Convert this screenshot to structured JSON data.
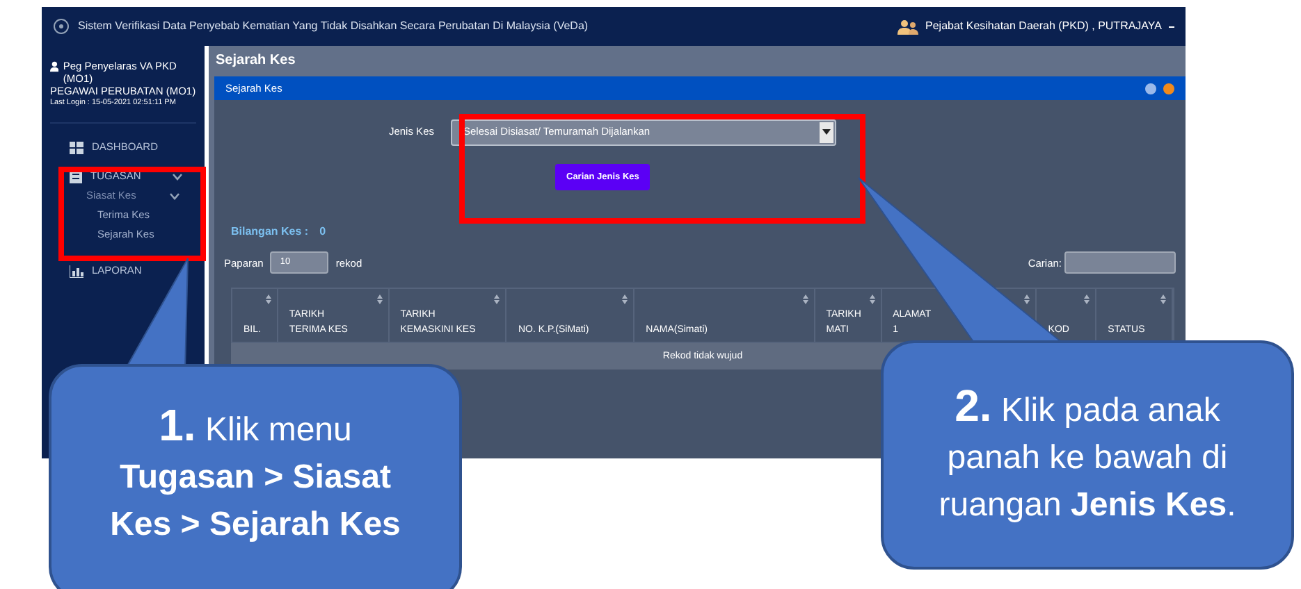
{
  "window": {
    "title": "Sistem Verifikasi Data Penyebab Kematian Yang Tidak Disahkan Secara Perubatan Di Malaysia (VeDa)",
    "office": "Pejabat Kesihatan Daerah (PKD) , PUTRAJAYA"
  },
  "user": {
    "name": "Peg Penyelaras VA PKD (MO1)",
    "role": "PEGAWAI PERUBATAN (MO1)",
    "last_login": "Last Login : 15-05-2021 02:51:11 PM"
  },
  "sidebar": {
    "items": [
      {
        "label": "DASHBOARD",
        "kind": "dashboard"
      },
      {
        "label": "TUGASAN",
        "kind": "tasks",
        "expanded": true,
        "children": [
          {
            "label": "Siasat Kes",
            "expanded": true,
            "children": [
              {
                "label": "Terima Kes"
              },
              {
                "label": "Sejarah Kes"
              }
            ]
          }
        ]
      },
      {
        "label": "LAPORAN",
        "kind": "report"
      }
    ]
  },
  "page_title": "Sejarah Kes",
  "panel": {
    "title": "Sejarah Kes",
    "form": {
      "label": "Jenis Kes",
      "value": "Selesai Disiasat/ Temuramah Dijalankan",
      "button": "Carian Jenis Kes"
    },
    "count_label": "Bilangan Kes :",
    "count": "0",
    "show_label": "Paparan",
    "show_value": "10",
    "show_suffix": "rekod",
    "search_label": "Carian:",
    "table": {
      "columns": [
        [
          "BIL."
        ],
        [
          "TARIKH",
          "TERIMA KES"
        ],
        [
          "TARIKH",
          "KEMASKINI KES"
        ],
        [
          "NO. K.P.(SiMati)"
        ],
        [
          "NAMA(Simati)"
        ],
        [
          "TARIKH",
          "MATI"
        ],
        [
          "ALAMAT",
          "1"
        ],
        [
          "KOD"
        ],
        [
          "STATUS"
        ]
      ],
      "empty": "Rekod tidak wujud"
    }
  },
  "callouts": [
    {
      "number": "1.",
      "text": "Klik menu **Tugasan > Siasat Kes > Sejarah Kes**"
    },
    {
      "number": "2.",
      "text": "Klik pada anak panah ke bawah di ruangan **Jenis Kes**."
    }
  ]
}
